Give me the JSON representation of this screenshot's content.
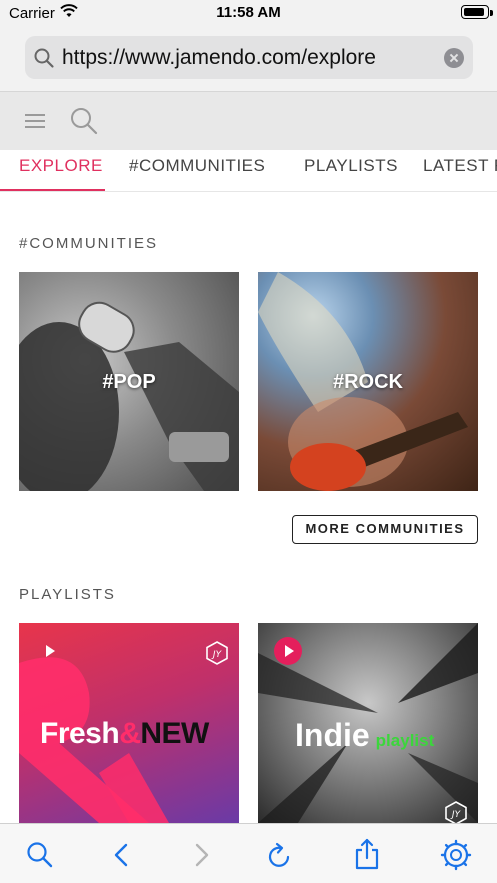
{
  "status_bar": {
    "carrier": "Carrier",
    "time": "11:58 AM",
    "battery_level": 0.95
  },
  "address_bar": {
    "url": "https://www.jamendo.com/explore"
  },
  "tabs": [
    {
      "label": "EXPLORE",
      "active": true
    },
    {
      "label": "#COMMUNITIES",
      "active": false
    },
    {
      "label": "PLAYLISTS",
      "active": false
    },
    {
      "label": "LATEST RE",
      "active": false
    }
  ],
  "communities": {
    "title": "#COMMUNITIES",
    "cards": [
      {
        "label": "#POP"
      },
      {
        "label": "#ROCK"
      }
    ],
    "more_label": "MORE COMMUNITIES"
  },
  "playlists": {
    "title": "PLAYLISTS",
    "cards": [
      {
        "word1": "Fresh",
        "amp": "&",
        "word2": "NEW"
      },
      {
        "word1": "Indie",
        "sub": "playlist"
      }
    ]
  },
  "colors": {
    "accent": "#e0305f",
    "toolbar_icon": "#1a73e8",
    "disabled_icon": "#b5b5b5"
  },
  "toolbar": [
    "search-icon",
    "back-icon",
    "forward-icon",
    "reload-icon",
    "share-icon",
    "settings-icon"
  ]
}
